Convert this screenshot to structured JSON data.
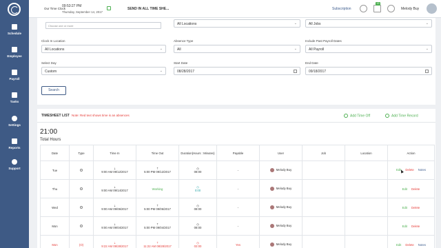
{
  "sidebar": {
    "items": [
      {
        "label": "Schedule",
        "icon": "calendar-icon"
      },
      {
        "label": "Employee",
        "icon": "people-icon"
      },
      {
        "label": "Payroll",
        "icon": "document-icon"
      },
      {
        "label": "Tasks",
        "icon": "tasks-icon"
      },
      {
        "label": "Settings",
        "icon": "gear-icon"
      },
      {
        "label": "Reports",
        "icon": "report-icon"
      },
      {
        "label": "Support",
        "icon": "support-icon"
      }
    ]
  },
  "topbar": {
    "app_title": "Our Time Clock",
    "time": "09:53:27 PM",
    "date": "Thursday, September 14, 2017",
    "send_label": "SEND IN ALL TIME SHE...",
    "subscription": "Subscription",
    "badge_count": "13",
    "user_name": "Melody Buy"
  },
  "filters": {
    "top_input_placeholder": "Choose one or more",
    "top_location": "All Locations",
    "top_jobs": "All Jobs",
    "clock_in_location_label": "Clock In Location",
    "clock_in_location": "All Locations",
    "absence_type_label": "Absence Type",
    "absence_type": "All",
    "past_payroll_label": "Include Past Payroll Dates",
    "past_payroll": "All Payroll",
    "select_day_label": "Select Day",
    "select_day": "Custom",
    "start_date_label": "Start Date",
    "start_date": "08/28/2017",
    "end_date_label": "End Date",
    "end_date": "09/18/2017",
    "search_label": "Search"
  },
  "timesheet": {
    "title": "TIMESHEET LIST",
    "note": "Note: Red text shows time is an absences",
    "add_time_off": "Add Time Off",
    "add_time_record": "Add Time Record",
    "total": "21:00",
    "total_label": "Total Hours",
    "columns": [
      "Date",
      "Type",
      "Time In",
      "Time Out",
      "Duration(Hours : Minutes)",
      "Payable",
      "User",
      "Job",
      "Location",
      "Action"
    ],
    "rows": [
      {
        "date": "Tue",
        "time_in": "9:00 AM 09/12/2017",
        "time_out": "5:00 PM 09/12/2017",
        "duration": "08:00",
        "payable": "-",
        "user": "Melody Buy",
        "actions": [
          "Edit",
          "Delete",
          "Notes"
        ],
        "absence": false,
        "working": false
      },
      {
        "date": "Thu",
        "time_in": "9:00 AM 09/14/2017",
        "time_out": "Working",
        "duration": "0:00",
        "payable": "-",
        "user": "Melody Buy",
        "actions": [
          "Edit",
          "Delete"
        ],
        "absence": false,
        "working": true
      },
      {
        "date": "Wed",
        "time_in": "9:00 AM 09/06/2017",
        "time_out": "5:00 PM 09/06/2017",
        "duration": "08:00",
        "payable": "-",
        "user": "Melody Buy",
        "actions": [
          "Edit",
          "Delete"
        ],
        "absence": false,
        "working": false
      },
      {
        "date": "Mon",
        "time_in": "9:00 AM 09/04/2017",
        "time_out": "5:00 PM 09/04/2017",
        "duration": "08:00",
        "payable": "-",
        "user": "Melody Buy",
        "actions": [
          "Edit",
          "Delete"
        ],
        "absence": false,
        "working": false
      },
      {
        "date": "Mon",
        "type": "(O)",
        "time_in": "9:22 AM 08/28/2017",
        "time_out": "11:22 AM 08/28/2017",
        "duration": "02:00",
        "payable": "Yes",
        "user": "Melody Buy",
        "actions": [
          "Edit",
          "Delete",
          "Notes"
        ],
        "absence": true,
        "working": false
      }
    ]
  },
  "colors": {
    "sidebar": "#3e5a85",
    "accent_green": "#4caf50",
    "absence_red": "#e53935",
    "link_blue": "#3a5a8c"
  }
}
